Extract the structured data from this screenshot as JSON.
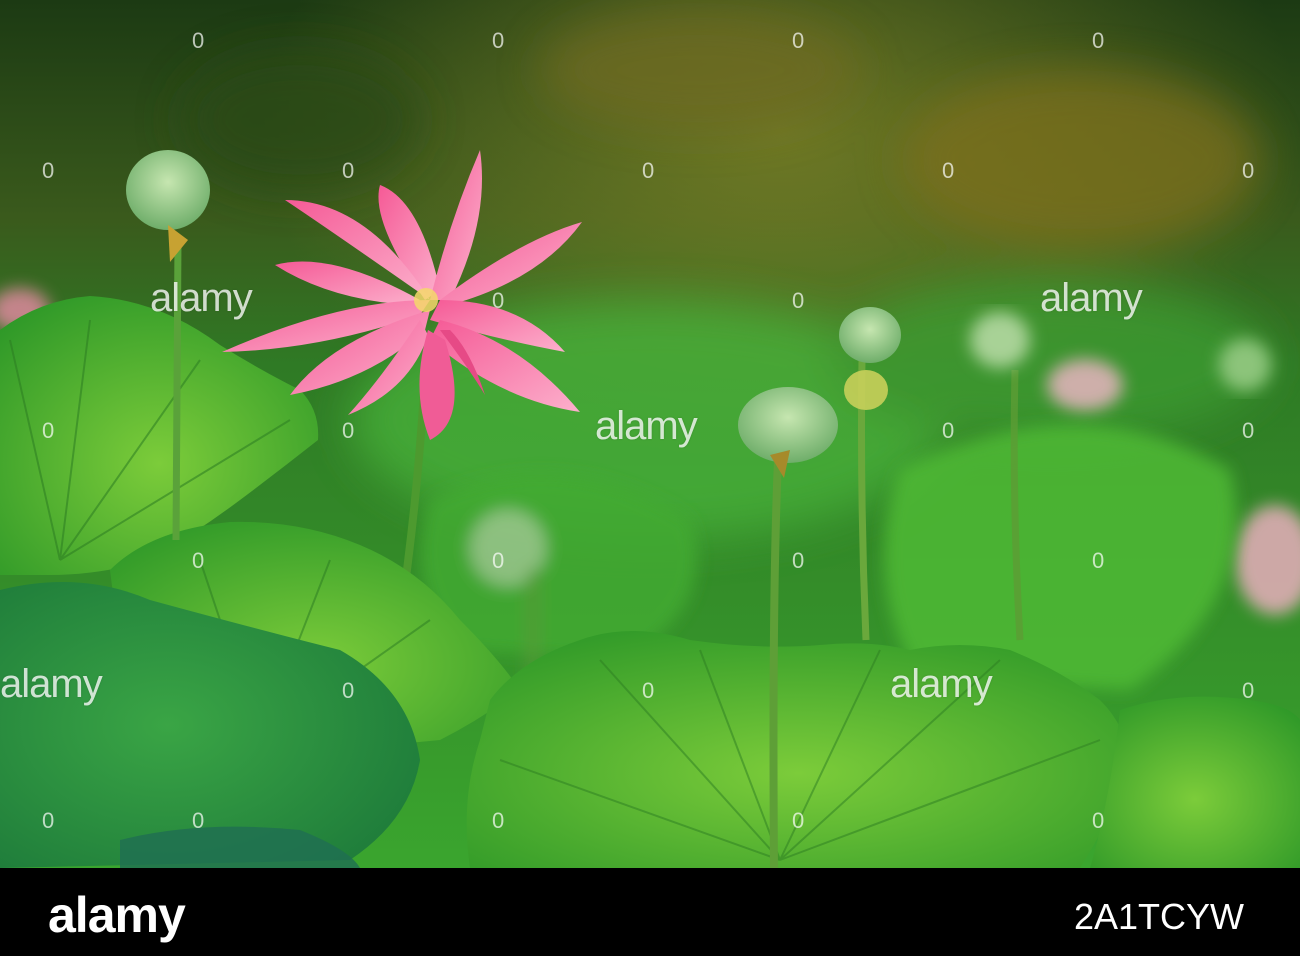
{
  "photo": {
    "subject": "pink-lotus-flower",
    "colors": {
      "background_dark": "#1f3d14",
      "leaf": "#3eaa2a",
      "petal": "#f0669a",
      "petal_light": "#fbb6cf"
    }
  },
  "watermark": {
    "text": "alamy",
    "dot": "0"
  },
  "footer": {
    "brand": "alamy",
    "stock_id": "2A1TCYW"
  }
}
